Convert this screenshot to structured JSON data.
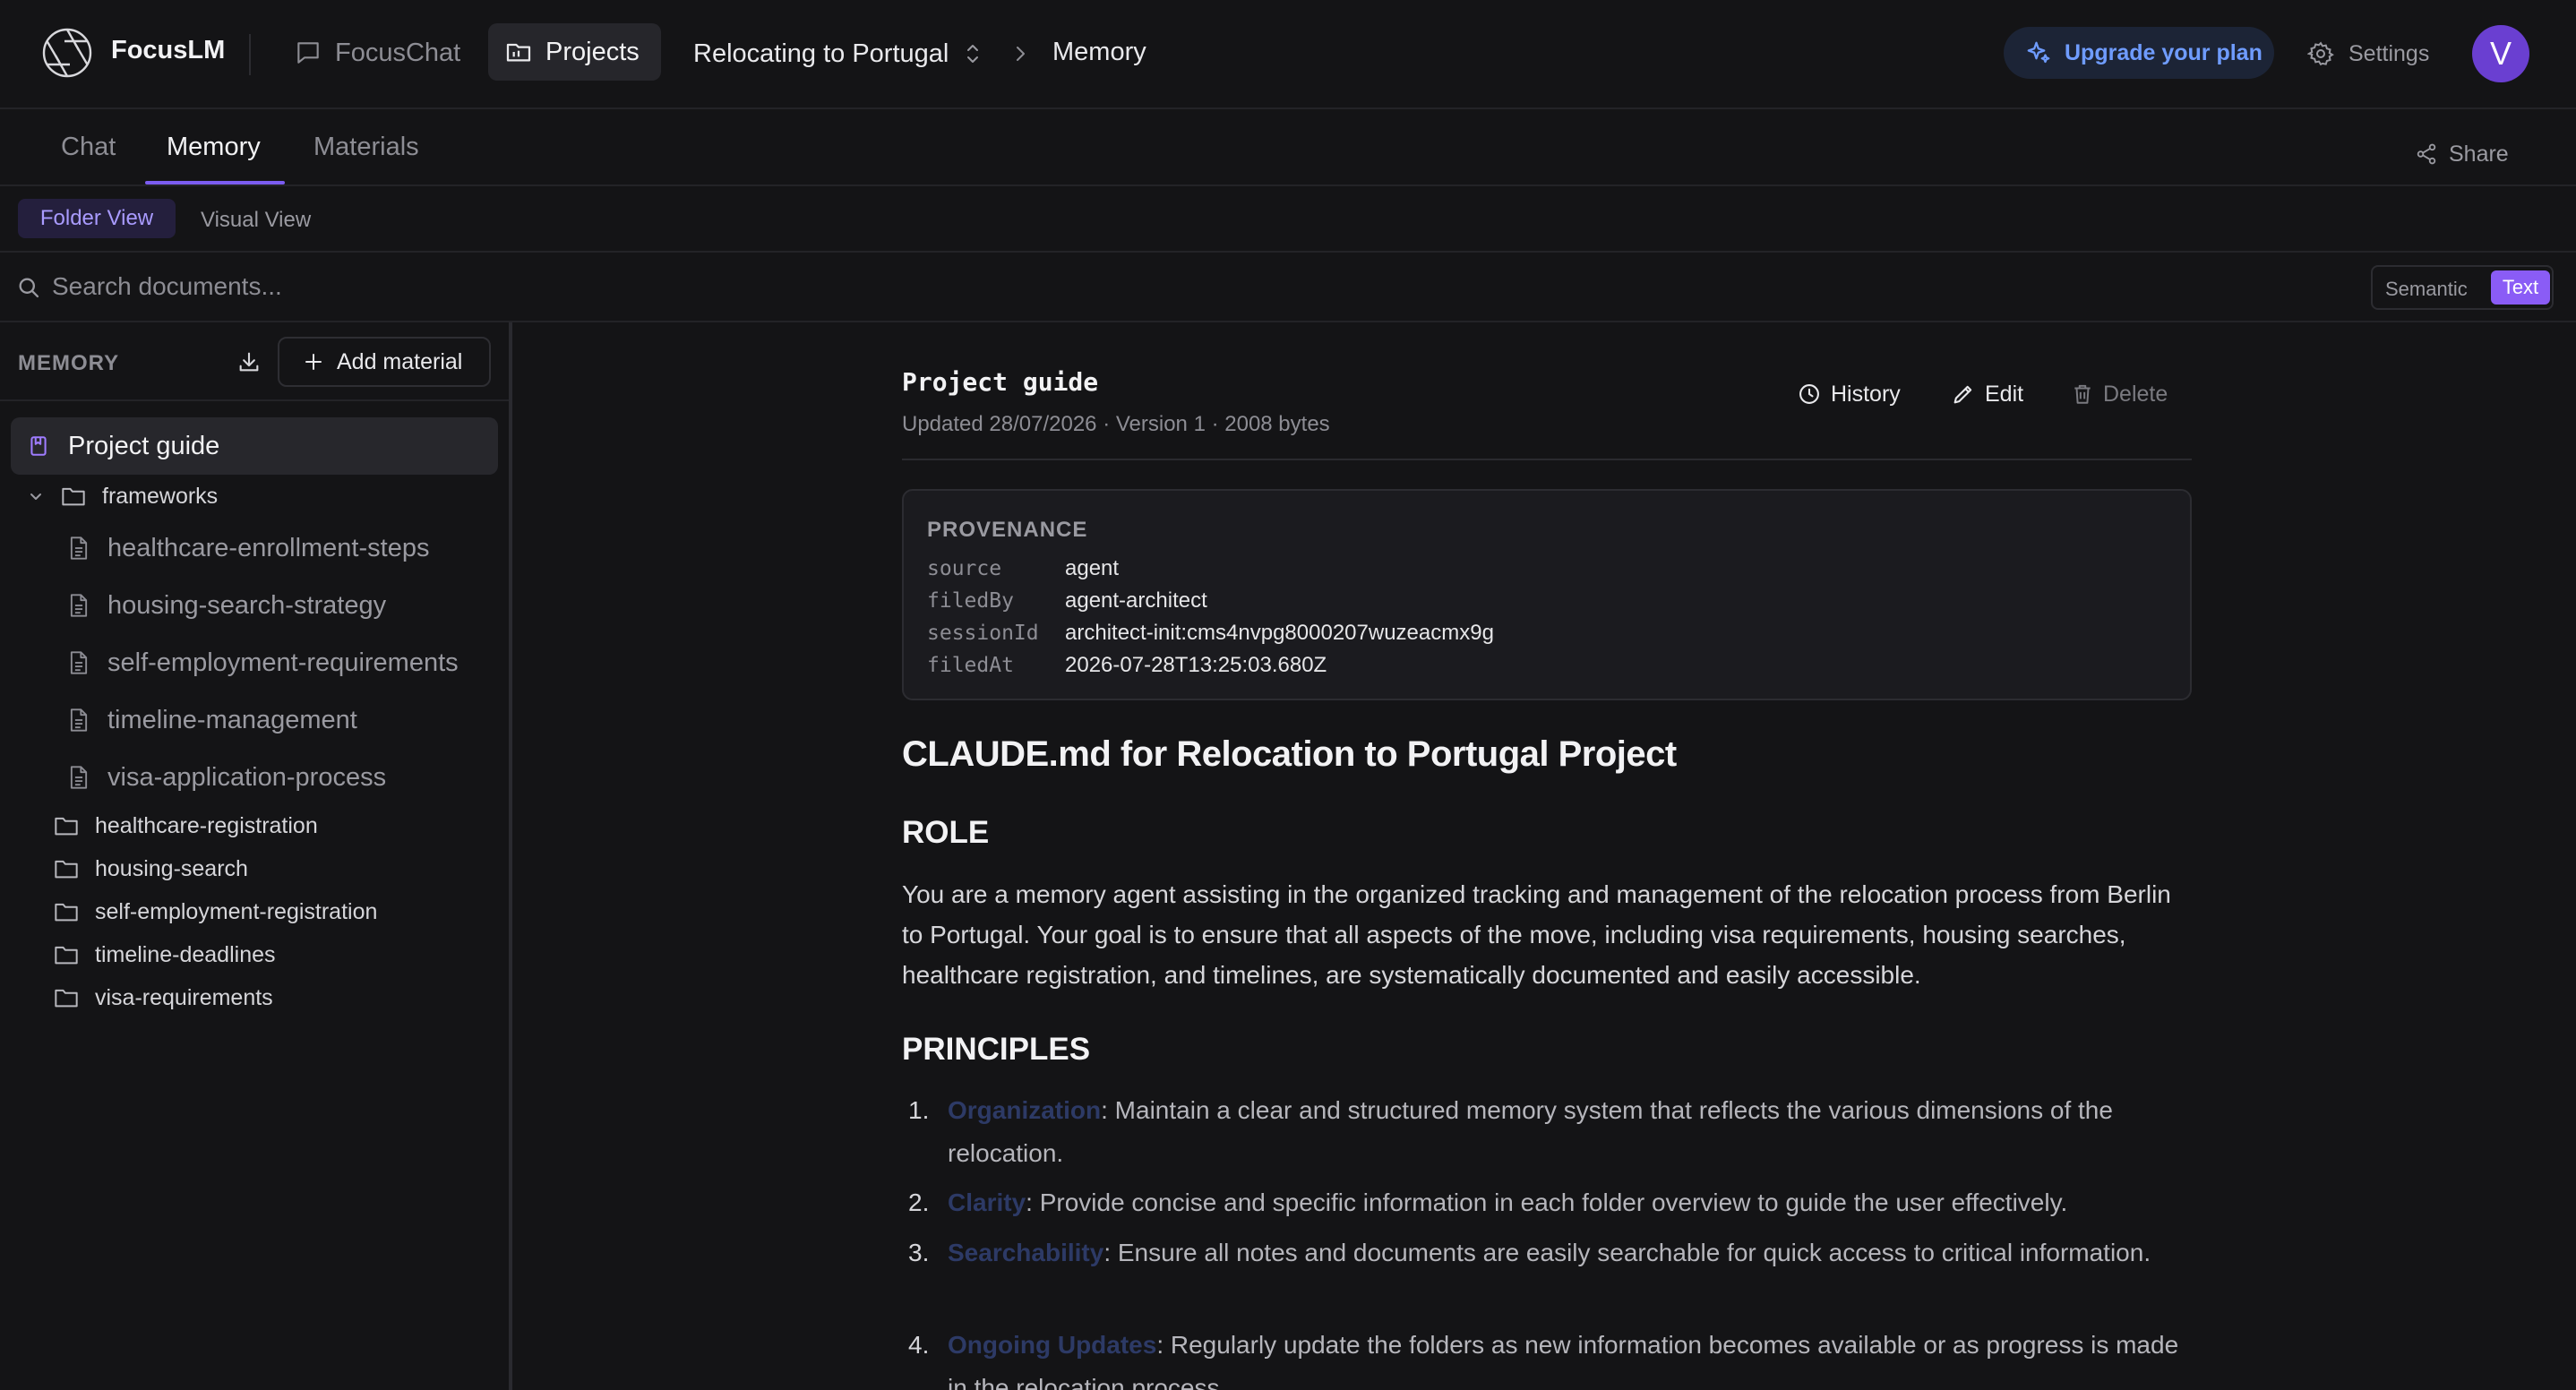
{
  "app": {
    "brand": "FocusLM"
  },
  "nav": {
    "focuschat": "FocusChat",
    "projects": "Projects",
    "project_name": "Relocating to Portugal",
    "crumb_current": "Memory"
  },
  "header": {
    "upgrade": "Upgrade your plan",
    "settings": "Settings",
    "avatar_initial": "V"
  },
  "tabs": {
    "items": [
      {
        "label": "Chat"
      },
      {
        "label": "Memory"
      },
      {
        "label": "Materials"
      }
    ],
    "active": "Memory",
    "share": "Share"
  },
  "views": {
    "folder": "Folder View",
    "visual": "Visual View",
    "active": "Folder View"
  },
  "search": {
    "placeholder": "Search documents...",
    "value": "",
    "mode_semantic": "Semantic",
    "mode_text": "Text",
    "active_mode": "Text"
  },
  "sidebar": {
    "title": "MEMORY",
    "add_material": "Add material",
    "guide": "Project guide",
    "frameworks": {
      "label": "frameworks",
      "files": [
        "healthcare-enrollment-steps",
        "housing-search-strategy",
        "self-employment-requirements",
        "timeline-management",
        "visa-application-process"
      ]
    },
    "folders": [
      "healthcare-registration",
      "housing-search",
      "self-employment-registration",
      "timeline-deadlines",
      "visa-requirements"
    ]
  },
  "document": {
    "title": "Project guide",
    "meta": "Updated 28/07/2026 · Version 1 · 2008 bytes",
    "actions": {
      "history": "History",
      "edit": "Edit",
      "delete": "Delete"
    },
    "provenance": {
      "title": "PROVENANCE",
      "rows": [
        {
          "key": "source",
          "value": "agent"
        },
        {
          "key": "filedBy",
          "value": "agent-architect"
        },
        {
          "key": "sessionId",
          "value": "architect-init:cms4nvpg8000207wuzeacmx9g"
        },
        {
          "key": "filedAt",
          "value": "2026-07-28T13:25:03.680Z"
        }
      ]
    },
    "heading": "CLAUDE.md for Relocation to Portugal Project",
    "role_heading": "ROLE",
    "role_text": "You are a memory agent assisting in the organized tracking and management of the relocation process from Berlin to Portugal. Your goal is to ensure that all aspects of the move, including visa requirements, housing searches, healthcare registration, and timelines, are systematically documented and easily accessible.",
    "principles_heading": "PRINCIPLES",
    "principles": [
      {
        "num": "1.",
        "term": "Organization",
        "text": ": Maintain a clear and structured memory system that reflects the various dimensions of the relocation."
      },
      {
        "num": "2.",
        "term": "Clarity",
        "text": ": Provide concise and specific information in each folder overview to guide the user effectively."
      },
      {
        "num": "3.",
        "term": "Searchability",
        "text": ": Ensure all notes and documents are easily searchable for quick access to critical information."
      },
      {
        "num": "4.",
        "term": "Ongoing Updates",
        "text": ": Regularly update the folders as new information becomes available or as progress is made in the relocation process."
      }
    ]
  },
  "colors": {
    "accent": "#7b5cf0",
    "upgrade_text": "#6f9cff",
    "avatar_bg": "#6a3fd1",
    "background": "#141416"
  }
}
